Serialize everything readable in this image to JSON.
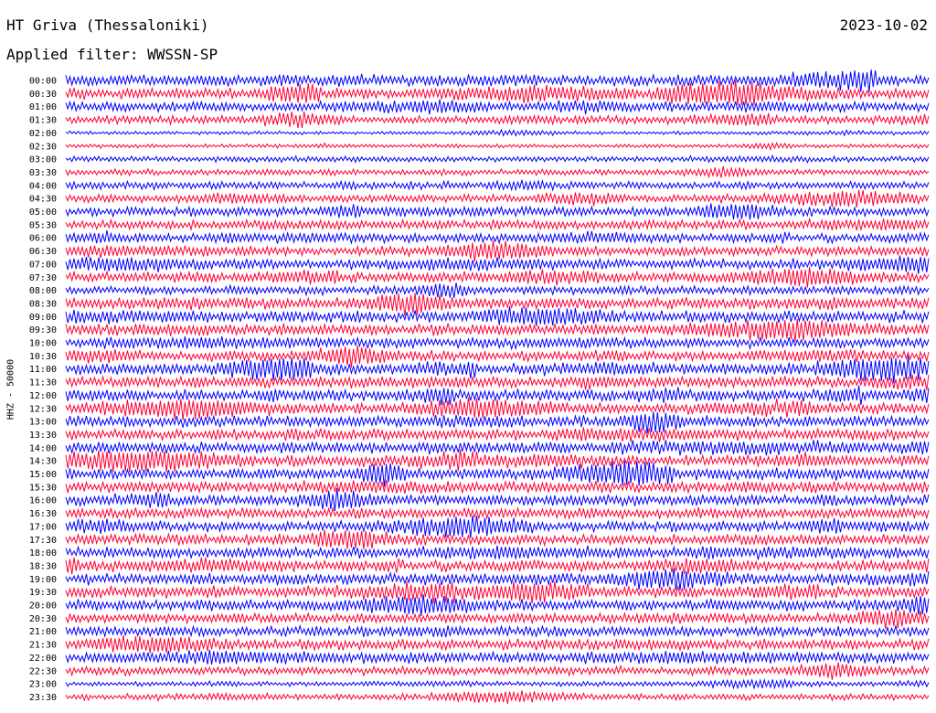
{
  "header": {
    "station": "HT Griva (Thessaloniki)",
    "date": "2023-10-02",
    "filter": "Applied filter: WWSSN-SP"
  },
  "chart_data": {
    "type": "line",
    "title": "HT Griva (Thessaloniki)",
    "ylabel": "HHZ - 50000",
    "xlabel": "",
    "traces_per_hour": 2,
    "trace_minutes": 30,
    "colors": [
      "#0000ff",
      "#ff0033"
    ],
    "tick_labels": [
      "00:00",
      "00:30",
      "01:00",
      "01:30",
      "02:00",
      "02:30",
      "03:00",
      "03:30",
      "04:00",
      "04:30",
      "05:00",
      "05:30",
      "06:00",
      "06:30",
      "07:00",
      "07:30",
      "08:00",
      "08:30",
      "09:00",
      "09:30",
      "10:00",
      "10:30",
      "11:00",
      "11:30",
      "12:00",
      "12:30",
      "13:00",
      "13:30",
      "14:00",
      "14:30",
      "15:00",
      "15:30",
      "16:00",
      "16:30",
      "17:00",
      "17:30",
      "18:00",
      "18:30",
      "19:00",
      "19:30",
      "20:00",
      "20:30",
      "21:00",
      "21:30",
      "22:00",
      "22:30",
      "23:00",
      "23:30"
    ],
    "activity_level": [
      0.9,
      0.85,
      0.75,
      0.6,
      0.15,
      0.2,
      0.35,
      0.4,
      0.55,
      0.6,
      0.7,
      0.75,
      0.7,
      0.75,
      0.8,
      0.85,
      0.65,
      0.9,
      0.95,
      0.95,
      0.85,
      0.85,
      0.9,
      0.9,
      0.9,
      0.9,
      0.9,
      0.9,
      0.95,
      0.9,
      0.9,
      0.9,
      0.85,
      0.85,
      0.8,
      0.85,
      0.9,
      0.9,
      0.95,
      0.95,
      0.9,
      0.75,
      0.8,
      0.85,
      0.9,
      0.65,
      0.3,
      0.4
    ],
    "grid": false,
    "legend": "none"
  }
}
